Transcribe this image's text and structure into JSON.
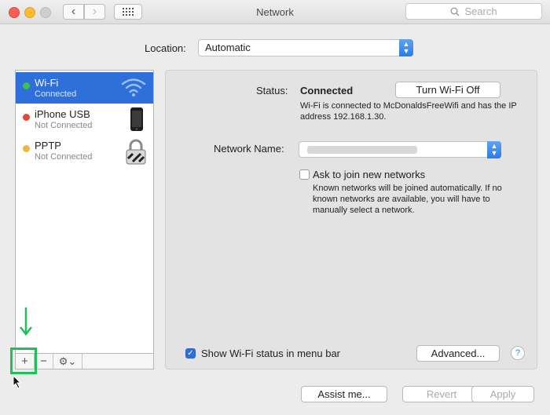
{
  "window": {
    "title": "Network",
    "search_placeholder": "Search"
  },
  "location": {
    "label": "Location:",
    "value": "Automatic"
  },
  "services": [
    {
      "name": "Wi-Fi",
      "status": "Connected",
      "dot_color": "#3cc24b",
      "icon": "wifi-icon",
      "selected": true
    },
    {
      "name": "iPhone USB",
      "status": "Not Connected",
      "dot_color": "#e8443c",
      "icon": "iphone-icon",
      "selected": false
    },
    {
      "name": "PPTP",
      "status": "Not Connected",
      "dot_color": "#f5b43a",
      "icon": "lock-icon",
      "selected": false
    }
  ],
  "tools": {
    "add": "+",
    "remove": "−",
    "action": "⚙⌄"
  },
  "detail": {
    "status_label": "Status:",
    "status_value": "Connected",
    "turn_off_label": "Turn Wi-Fi Off",
    "status_description": "Wi-Fi is connected to McDonaldsFreeWifi and has the IP address 192.168.1.30.",
    "network_name_label": "Network Name:",
    "ask_label": "Ask to join new networks",
    "ask_checked": false,
    "ask_description": "Known networks will be joined automatically. If no known networks are available, you will have to manually select a network."
  },
  "footer": {
    "show_wifi_label": "Show Wi-Fi status in menu bar",
    "show_wifi_checked": true,
    "advanced_label": "Advanced...",
    "help_label": "?",
    "assist_label": "Assist me...",
    "revert_label": "Revert",
    "apply_label": "Apply"
  }
}
